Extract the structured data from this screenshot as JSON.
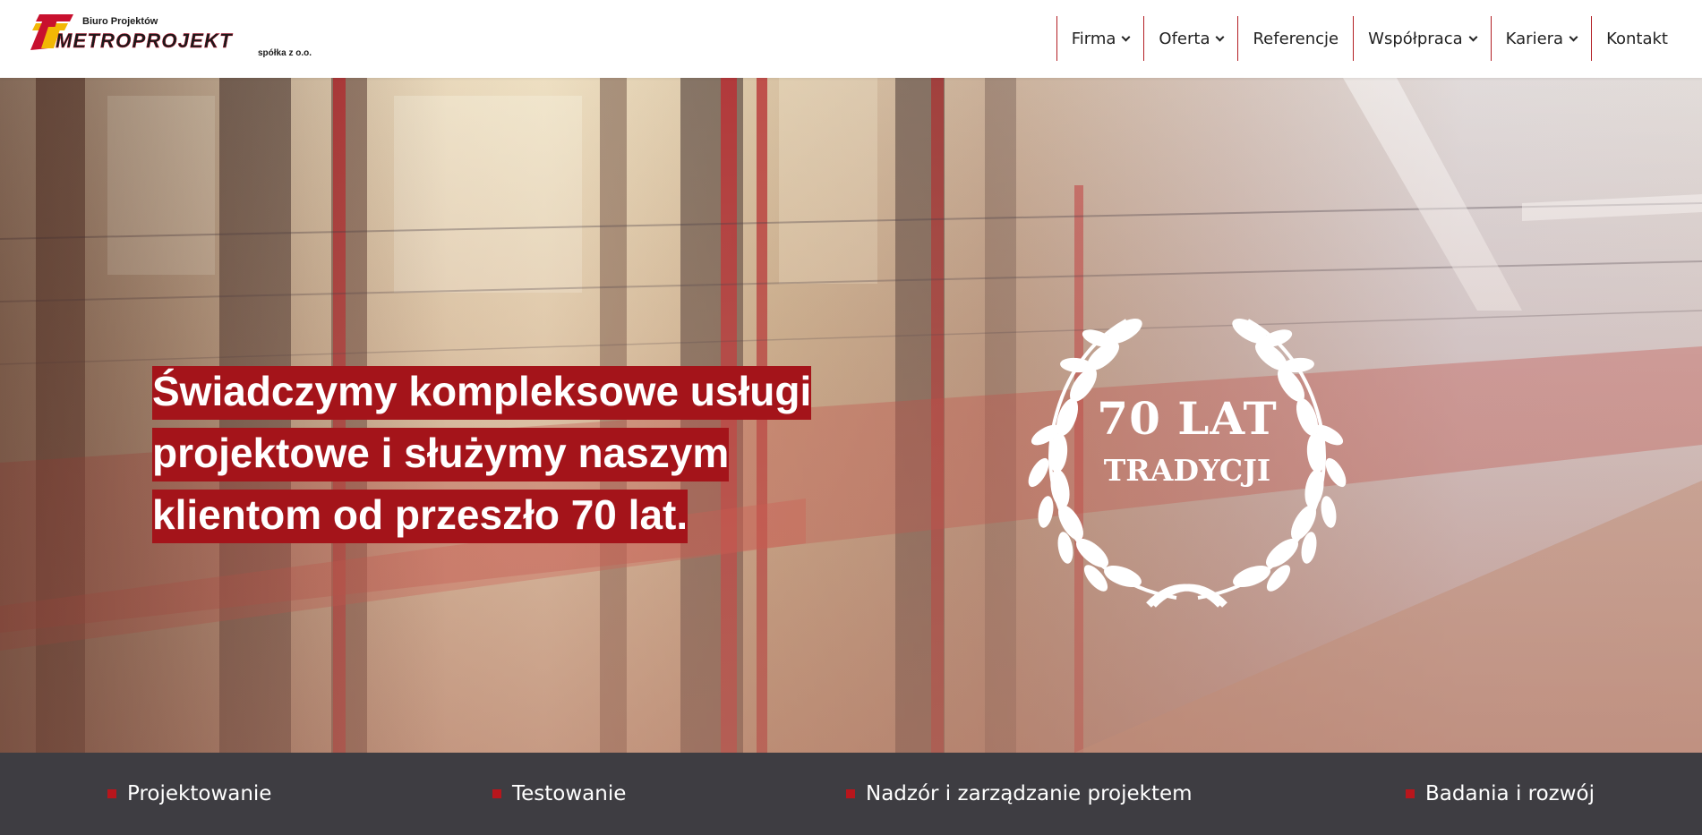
{
  "logo": {
    "top_line": "Biuro Projektów",
    "name": "METROPROJEKT",
    "sub_line": "spółka z o.o."
  },
  "nav": {
    "items": [
      {
        "label": "Firma",
        "has_dropdown": true
      },
      {
        "label": "Oferta",
        "has_dropdown": true
      },
      {
        "label": "Referencje",
        "has_dropdown": false
      },
      {
        "label": "Współpraca",
        "has_dropdown": true
      },
      {
        "label": "Kariera",
        "has_dropdown": true
      },
      {
        "label": "Kontakt",
        "has_dropdown": false
      }
    ]
  },
  "hero": {
    "headline_lines": [
      "Świadczymy kompleksowe usługi",
      "projektowe i służymy naszym",
      "klientom od przeszło 70 lat."
    ],
    "badge_line1": "70 LAT",
    "badge_line2": "TRADYCJI"
  },
  "services": [
    {
      "label": "Projektowanie"
    },
    {
      "label": "Testowanie"
    },
    {
      "label": "Nadzór i zarządzanie projektem"
    },
    {
      "label": "Badania i rozwój"
    }
  ],
  "colors": {
    "brand_red": "#a4141a",
    "nav_divider": "#b31f24",
    "services_bg": "#3e3d42",
    "bullet": "#b8161c"
  },
  "icons": [
    "chevron-down-icon",
    "laurel-wreath-icon",
    "bullet-square-icon"
  ]
}
